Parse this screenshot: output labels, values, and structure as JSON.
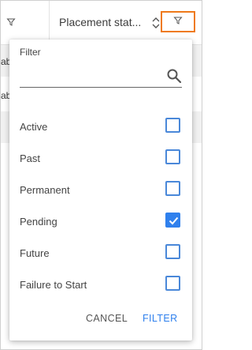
{
  "header": {
    "column_title": "Placement stat...",
    "left_icon": "funnel-icon",
    "sort_icon": "sort-updown-icon",
    "filter_icon": "funnel-icon",
    "filter_button_border_color": "#ef7a1a"
  },
  "background_rows": [
    {
      "fragment": "ab"
    },
    {
      "fragment": "ab"
    }
  ],
  "filter_popup": {
    "title": "Filter",
    "search": {
      "value": "",
      "placeholder": "",
      "icon": "search-icon"
    },
    "options": [
      {
        "label": "Active",
        "checked": false
      },
      {
        "label": "Past",
        "checked": false
      },
      {
        "label": "Permanent",
        "checked": false
      },
      {
        "label": "Pending",
        "checked": true
      },
      {
        "label": "Future",
        "checked": false
      },
      {
        "label": "Failure to Start",
        "checked": false
      }
    ],
    "cancel_label": "CANCEL",
    "apply_label": "FILTER",
    "accent_color": "#2f80ed"
  }
}
